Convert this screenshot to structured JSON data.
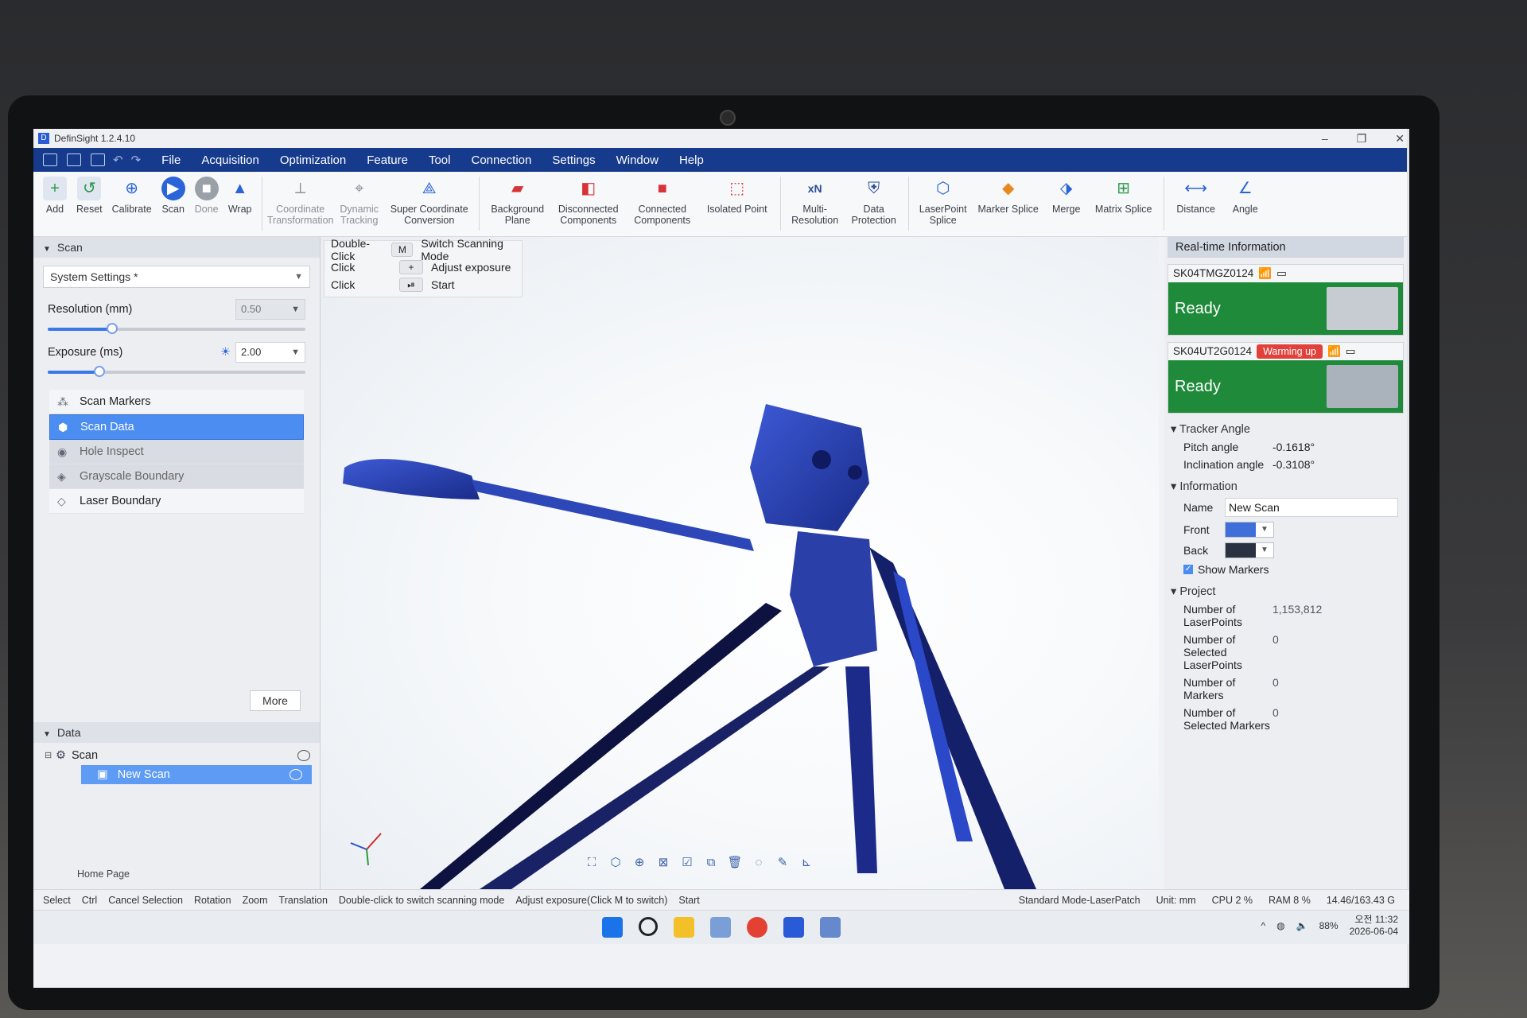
{
  "window": {
    "title": "DefinSight 1.2.4.10"
  },
  "menubar": {
    "items": [
      "File",
      "Acquisition",
      "Optimization",
      "Feature",
      "Tool",
      "Connection",
      "Settings",
      "Window",
      "Help"
    ]
  },
  "ribbon": {
    "tools": [
      {
        "label": "Add",
        "icon": "add-icon"
      },
      {
        "label": "Reset",
        "icon": "reset-icon"
      },
      {
        "label": "Calibrate",
        "icon": "calibrate-icon"
      },
      {
        "label": "Scan",
        "icon": "scan-play-icon"
      },
      {
        "label": "Done",
        "icon": "stop-icon"
      },
      {
        "label": "Wrap",
        "icon": "wrap-icon"
      },
      {
        "label": "Coordinate Transformation",
        "icon": "coordinate-icon"
      },
      {
        "label": "Dynamic Tracking",
        "icon": "tracking-icon"
      },
      {
        "label": "Super Coordinate Conversion",
        "icon": "super-coordinate-icon"
      },
      {
        "label": "Background Plane",
        "icon": "background-plane-icon"
      },
      {
        "label": "Disconnected Components",
        "icon": "disconnected-icon"
      },
      {
        "label": "Connected Components",
        "icon": "connected-icon"
      },
      {
        "label": "Isolated Point",
        "icon": "isolated-point-icon"
      },
      {
        "label": "Multi-Resolution",
        "icon": "multi-resolution-icon"
      },
      {
        "label": "Data Protection",
        "icon": "data-protection-icon"
      },
      {
        "label": "LaserPoint Splice",
        "icon": "laserpoint-splice-icon"
      },
      {
        "label": "Marker Splice",
        "icon": "marker-splice-icon"
      },
      {
        "label": "Merge",
        "icon": "merge-icon"
      },
      {
        "label": "Matrix Splice",
        "icon": "matrix-splice-icon"
      },
      {
        "label": "Distance",
        "icon": "distance-icon"
      },
      {
        "label": "Angle",
        "icon": "angle-icon"
      }
    ]
  },
  "scan_panel": {
    "header": "Scan",
    "settings_select": "System Settings *",
    "resolution_label": "Resolution (mm)",
    "resolution_value": "0.50",
    "resolution_level": 0.25,
    "exposure_label": "Exposure (ms)",
    "exposure_value": "2.00",
    "exposure_level": 0.2,
    "modes": [
      "Scan Markers",
      "Scan Data",
      "Hole Inspect",
      "Grayscale Boundary",
      "Laser Boundary"
    ],
    "more_label": "More"
  },
  "data_panel": {
    "header": "Data",
    "tree_root": "Scan",
    "tree_child": "New Scan"
  },
  "hints": [
    {
      "action": "Double-Click",
      "key": "M",
      "desc": "Switch Scanning Mode"
    },
    {
      "action": "Click",
      "key": "+",
      "desc": "Adjust exposure"
    },
    {
      "action": "Click",
      "key": "⏯",
      "desc": "Start"
    }
  ],
  "realtime": {
    "header": "Real-time Information",
    "device1": {
      "id": "SK04TMGZ0124",
      "status": "Ready"
    },
    "device2": {
      "id": "SK04UT2G0124",
      "badge": "Warming up",
      "status": "Ready"
    },
    "tracker": {
      "header": "Tracker Angle",
      "pitch_label": "Pitch angle",
      "pitch": "-0.1618°",
      "incl_label": "Inclination angle",
      "incl": "-0.3108°"
    },
    "information": {
      "header": "Information",
      "name_label": "Name",
      "name_value": "New Scan",
      "front_label": "Front",
      "back_label": "Back",
      "front_color": "#3f6fd8",
      "back_color": "#2a3140",
      "show_markers": "Show Markers"
    },
    "project": {
      "header": "Project",
      "rows": [
        {
          "k": "Number of LaserPoints",
          "v": "1,153,812"
        },
        {
          "k": "Number of Selected LaserPoints",
          "v": "0"
        },
        {
          "k": "Number of Markers",
          "v": "0"
        },
        {
          "k": "Number of Selected Markers",
          "v": "0"
        }
      ]
    }
  },
  "statusbar": {
    "home_page": "Home Page",
    "left_items": [
      "Select",
      "Ctrl",
      "Cancel Selection",
      "Rotation",
      "Zoom",
      "Translation",
      "Double-click to switch scanning mode",
      "Adjust exposure(Click M to switch)",
      "Start"
    ],
    "mode": "Standard Mode-LaserPatch",
    "unit": "Unit: mm",
    "cpu": "CPU 2 %",
    "ram": "RAM 8 %",
    "mem": "14.46/163.43 G"
  },
  "tray": {
    "battery": "88%",
    "time": "오전 11:32",
    "date": "2026-06-04"
  },
  "colors": {
    "menubar": "#163a8c",
    "ready": "#1e8a3a",
    "warn": "#e0413a",
    "accent": "#4b8df0"
  }
}
